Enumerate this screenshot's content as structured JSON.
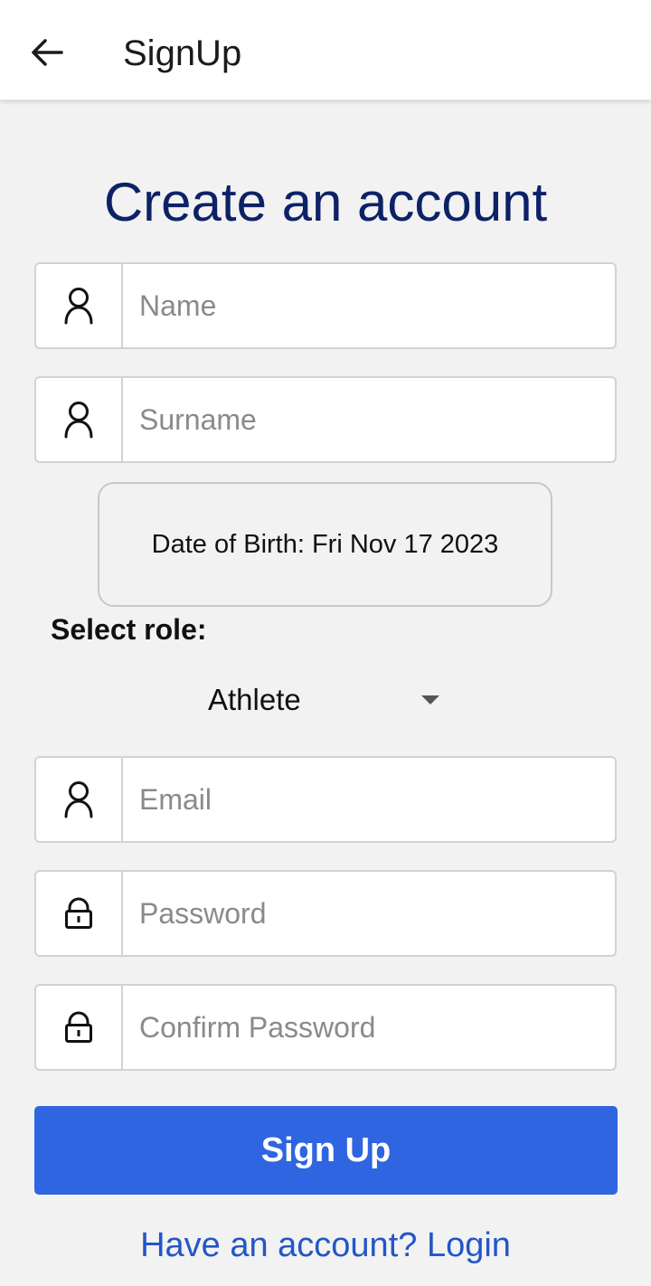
{
  "appbar": {
    "title": "SignUp",
    "back_icon": "arrow-left-icon"
  },
  "heading": "Create an account",
  "fields": {
    "name": {
      "placeholder": "Name",
      "value": "",
      "icon": "user-icon"
    },
    "surname": {
      "placeholder": "Surname",
      "value": "",
      "icon": "user-icon"
    },
    "email": {
      "placeholder": "Email",
      "value": "",
      "icon": "user-icon"
    },
    "password": {
      "placeholder": "Password",
      "value": "",
      "icon": "lock-icon"
    },
    "confirm_password": {
      "placeholder": "Confirm Password",
      "value": "",
      "icon": "lock-icon"
    }
  },
  "dob": {
    "label": "Date of Birth: Fri Nov 17 2023"
  },
  "role": {
    "label": "Select role:",
    "selected": "Athlete"
  },
  "actions": {
    "signup_label": "Sign Up",
    "login_link": "Have an account? Login"
  },
  "colors": {
    "primary": "#2f65e0",
    "heading": "#0d2266",
    "link": "#2356c7",
    "background": "#f2f2f2"
  }
}
